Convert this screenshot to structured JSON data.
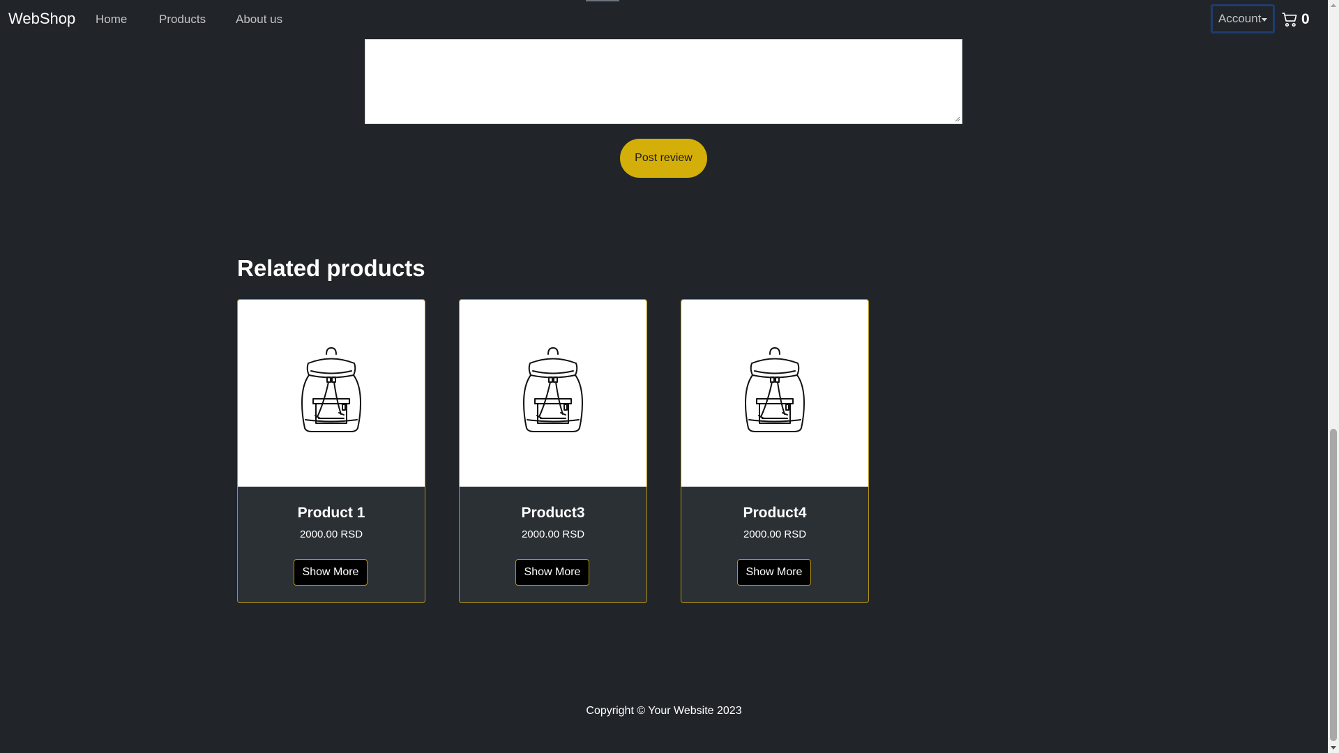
{
  "navbar": {
    "brand": "WebShop",
    "links": [
      "Home",
      "Products",
      "About us"
    ],
    "account_label": "Account",
    "cart_count": "0"
  },
  "review": {
    "textarea_value": "",
    "post_button": "Post review"
  },
  "related": {
    "title": "Related products",
    "products": [
      {
        "name": "Product 1",
        "price": "2000.00 RSD",
        "button": "Show More",
        "icon": "backpack-icon"
      },
      {
        "name": "Product3",
        "price": "2000.00 RSD",
        "button": "Show More",
        "icon": "backpack-icon"
      },
      {
        "name": "Product4",
        "price": "2000.00 RSD",
        "button": "Show More",
        "icon": "backpack-icon"
      }
    ]
  },
  "footer": {
    "copyright": "Copyright © Your Website 2023"
  },
  "colors": {
    "background": "#212529",
    "accent": "#d4af0a",
    "card_border": "#b19316",
    "card_body": "#2b3035"
  },
  "icons": [
    "cart-icon",
    "chevron-down-icon",
    "backpack-icon"
  ]
}
